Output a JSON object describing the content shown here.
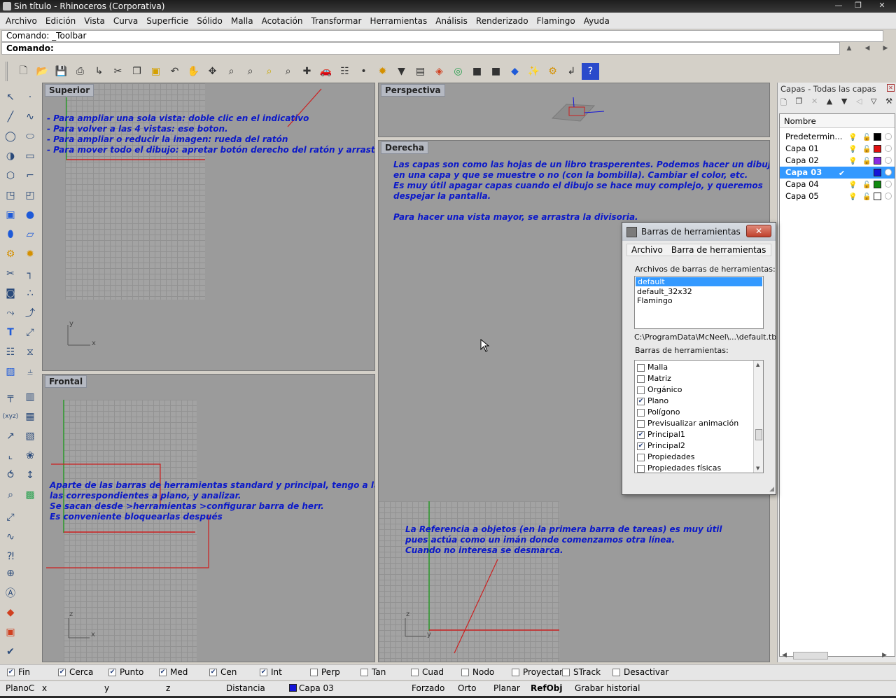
{
  "window": {
    "title": "Sin título - Rhinoceros (Corporativa)"
  },
  "menu": [
    "Archivo",
    "Edición",
    "Vista",
    "Curva",
    "Superficie",
    "Sólido",
    "Malla",
    "Acotación",
    "Transformar",
    "Herramientas",
    "Análisis",
    "Renderizado",
    "Flamingo",
    "Ayuda"
  ],
  "command": {
    "history": "Comando: _Toolbar",
    "prompt": "Comando:"
  },
  "viewports": {
    "superior": {
      "label": "Superior",
      "note": "- Para ampliar una sola vista: doble clic en el indicativo\n- Para volver a las 4 vistas: ese boton.\n- Para ampliar o reducir la imagen: rueda del ratón\n- Para mover todo el dibujo: apretar botón derecho del ratón y arrastrar",
      "axis_y": "y",
      "axis_x": "x"
    },
    "perspectiva": {
      "label": "Perspectiva"
    },
    "derecha": {
      "label": "Derecha",
      "note1": "Las capas son como las hojas de un libro trasperentes. Podemos hacer un dibujo\nen una capa y que se muestre o no (con la bombilla). Cambiar el color, etc.\nEs muy útil apagar capas cuando el dibujo se hace muy complejo, y queremos\ndespejar la pantalla.\n\nPara hacer una vista mayor, se arrastra la divisoria.",
      "note2": "La Referencia a objetos (en la primera barra de tareas) es muy útil\npues actúa como un imán donde comenzamos otra línea.\nCuando no interesa se desmarca.",
      "axis_z": "z",
      "axis_y": "y"
    },
    "frontal": {
      "label": "Frontal",
      "note": "Aparte de las barras de herramientas standard y principal, tengo a la vista\nlas correspondientes a plano, y analizar.\nSe sacan desde >herramientas >configurar barra de herr.\nEs conveniente bloquearlas después",
      "axis_z": "z",
      "axis_x": "x"
    }
  },
  "layers": {
    "title": "Capas - Todas las capas",
    "column": "Nombre",
    "rows": [
      {
        "name": "Predetermin...",
        "color": "#000000"
      },
      {
        "name": "Capa 01",
        "color": "#e01010"
      },
      {
        "name": "Capa 02",
        "color": "#8a2be2"
      },
      {
        "name": "Capa 03",
        "color": "#1414d8",
        "current_mark": "✔"
      },
      {
        "name": "Capa 04",
        "color": "#108a10"
      },
      {
        "name": "Capa 05",
        "color": "#ffffff"
      }
    ]
  },
  "dialog": {
    "title": "Barras de herramientas",
    "close": "✕",
    "menu": [
      "Archivo",
      "Barra de herramientas"
    ],
    "files_label": "Archivos de barras de herramientas:",
    "files": [
      "default",
      "default_32x32",
      "Flamingo"
    ],
    "path": "C:\\ProgramData\\McNeel\\...\\default.tb",
    "toolbars_label": "Barras de herramientas:",
    "toolbars": [
      {
        "name": "Malla",
        "checked": false
      },
      {
        "name": "Matriz",
        "checked": false
      },
      {
        "name": "Orgánico",
        "checked": false
      },
      {
        "name": "Plano",
        "checked": true
      },
      {
        "name": "Polígono",
        "checked": false
      },
      {
        "name": "Previsualizar animación",
        "checked": false
      },
      {
        "name": "Principal1",
        "checked": true
      },
      {
        "name": "Principal2",
        "checked": true
      },
      {
        "name": "Propiedades",
        "checked": false
      },
      {
        "name": "Propiedades físicas",
        "checked": false
      }
    ]
  },
  "osnap": [
    {
      "label": "Fin",
      "checked": true
    },
    {
      "label": "Cerca",
      "checked": true
    },
    {
      "label": "Punto",
      "checked": true
    },
    {
      "label": "Med",
      "checked": true
    },
    {
      "label": "Cen",
      "checked": true
    },
    {
      "label": "Int",
      "checked": true
    },
    {
      "label": "Perp",
      "checked": false
    },
    {
      "label": "Tan",
      "checked": false
    },
    {
      "label": "Cuad",
      "checked": false
    },
    {
      "label": "Nodo",
      "checked": false
    },
    {
      "label": "Proyectar",
      "checked": false
    },
    {
      "label": "STrack",
      "checked": false
    },
    {
      "label": "Desactivar",
      "checked": false
    }
  ],
  "status": {
    "plane": "PlanoC",
    "x": "x",
    "y": "y",
    "z": "z",
    "distance": "Distancia",
    "layer": "Capa 03",
    "forzado": "Forzado",
    "orto": "Orto",
    "planar": "Planar",
    "refobj": "RefObj",
    "history": "Grabar historial"
  }
}
